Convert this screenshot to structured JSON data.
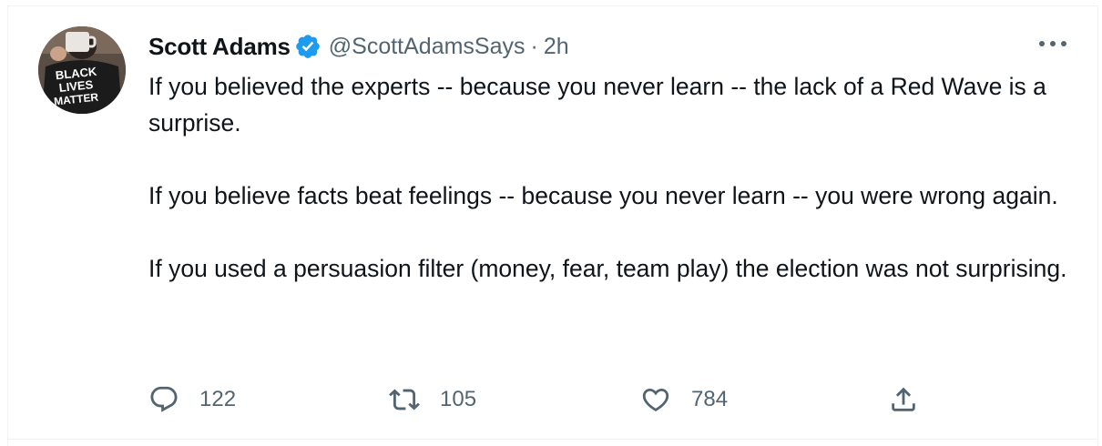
{
  "tweet": {
    "author": {
      "name": "Scott Adams",
      "handle": "@ScottAdamsSays",
      "verified": true,
      "avatar_shirt_text": "BLACK LIVES MATTER"
    },
    "separator": "·",
    "timestamp": "2h",
    "paragraphs": [
      "If you believed the experts -- because you never learn -- the lack of a Red Wave is a surprise.",
      "If you believe facts beat feelings -- because you never learn -- you were wrong again.",
      "If you used a persuasion filter (money, fear, team play) the election was not surprising."
    ],
    "actions": {
      "reply": {
        "icon": "reply-icon",
        "count": "122"
      },
      "retweet": {
        "icon": "retweet-icon",
        "count": "105"
      },
      "like": {
        "icon": "heart-icon",
        "count": "784"
      },
      "share": {
        "icon": "share-icon"
      }
    },
    "more_icon": "more-icon"
  },
  "colors": {
    "text_primary": "#0f1419",
    "text_secondary": "#536471",
    "verified_blue": "#1d9bf0",
    "border": "#eff3f4"
  }
}
